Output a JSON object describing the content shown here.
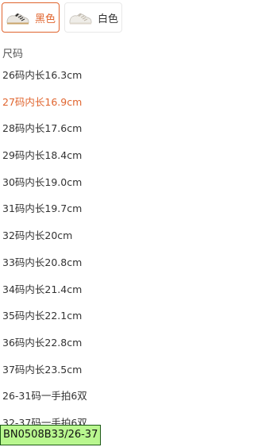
{
  "colors": [
    {
      "label": "黑色",
      "selected": true,
      "icon": "black-shoe-thumbnail"
    },
    {
      "label": "白色",
      "selected": false,
      "icon": "white-shoe-thumbnail"
    }
  ],
  "section_title": "尺码",
  "sizes": [
    {
      "label": "26码内长16.3cm",
      "selected": false
    },
    {
      "label": "27码内长16.9cm",
      "selected": true
    },
    {
      "label": "28码内长17.6cm",
      "selected": false
    },
    {
      "label": "29码内长18.4cm",
      "selected": false
    },
    {
      "label": "30码内长19.0cm",
      "selected": false
    },
    {
      "label": "31码内长19.7cm",
      "selected": false
    },
    {
      "label": "32码内长20cm",
      "selected": false
    },
    {
      "label": "33码内长20.8cm",
      "selected": false
    },
    {
      "label": "34码内长21.4cm",
      "selected": false
    },
    {
      "label": "35码内长22.1cm",
      "selected": false
    },
    {
      "label": "36码内长22.8cm",
      "selected": false
    },
    {
      "label": "37码内长23.5cm",
      "selected": false
    },
    {
      "label": "26-31码一手拍6双",
      "selected": false
    },
    {
      "label": "32-37码一手拍6双",
      "selected": false
    }
  ],
  "sku_tag": "BN0508B33/26-37",
  "accent_color": "#e0652f"
}
